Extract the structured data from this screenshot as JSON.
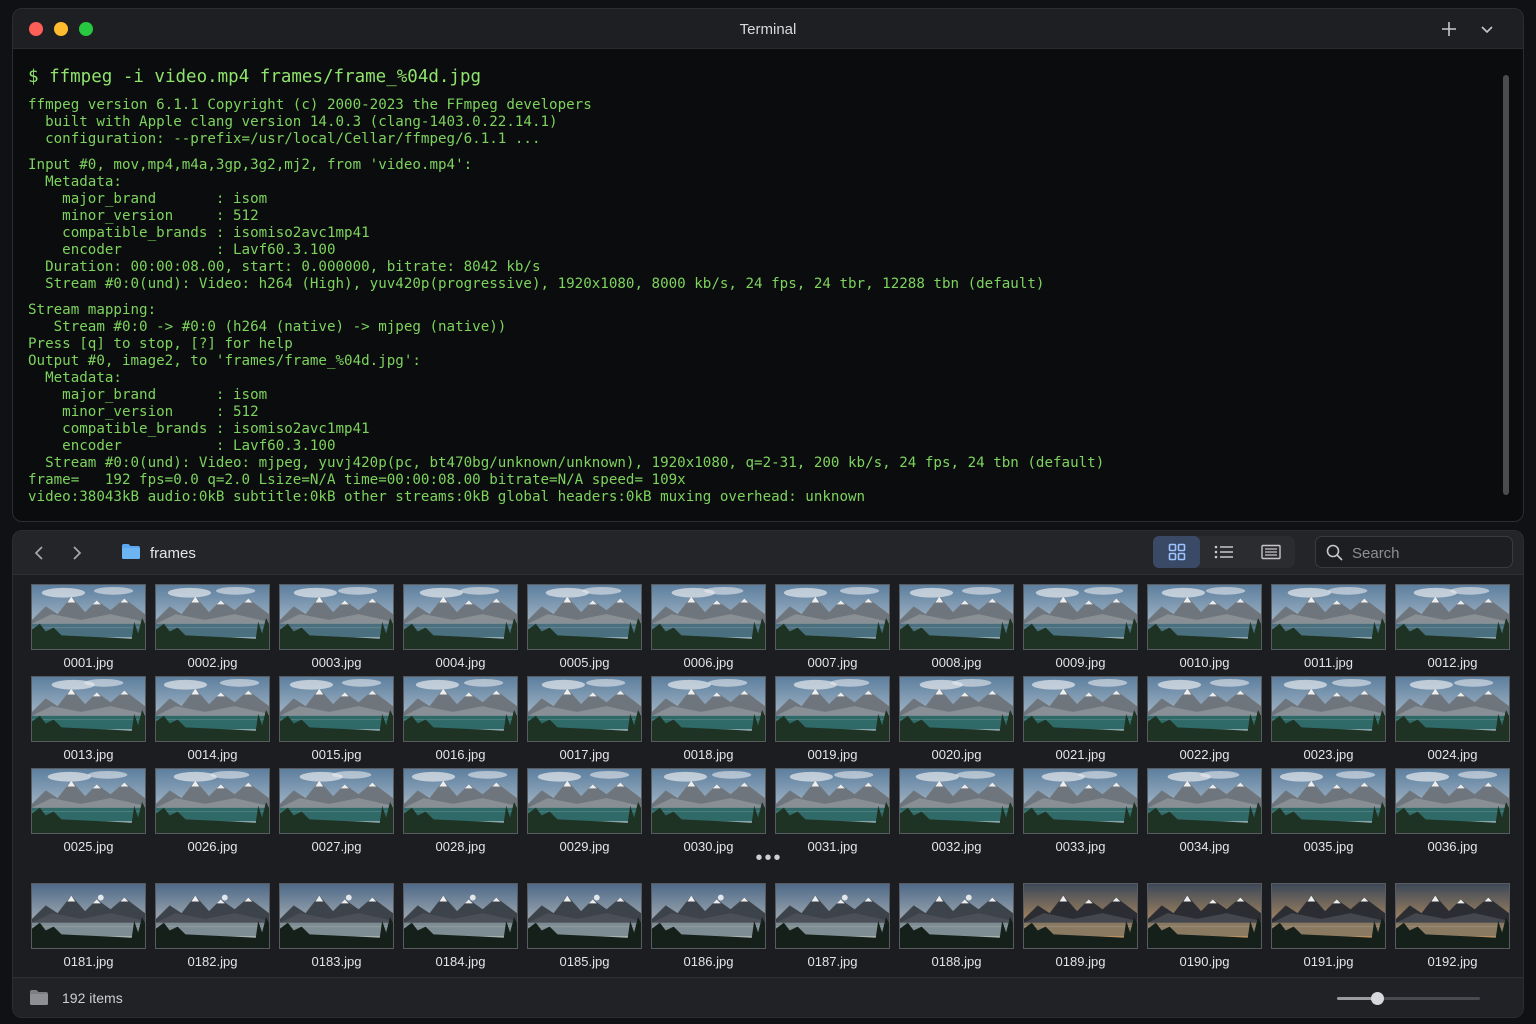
{
  "terminal": {
    "title": "Terminal",
    "command": "$ ffmpeg -i video.mp4 frames/frame_%04d.jpg",
    "blocks": [
      [
        "ffmpeg version 6.1.1 Copyright (c) 2000-2023 the FFmpeg developers",
        "  built with Apple clang version 14.0.3 (clang-1403.0.22.14.1)",
        "  configuration: --prefix=/usr/local/Cellar/ffmpeg/6.1.1 ..."
      ],
      [
        "Input #0, mov,mp4,m4a,3gp,3g2,mj2, from 'video.mp4':",
        "  Metadata:",
        "    major_brand       : isom",
        "    minor_version     : 512",
        "    compatible_brands : isomiso2avc1mp41",
        "    encoder           : Lavf60.3.100",
        "  Duration: 00:00:08.00, start: 0.000000, bitrate: 8042 kb/s",
        "  Stream #0:0(und): Video: h264 (High), yuv420p(progressive), 1920x1080, 8000 kb/s, 24 fps, 24 tbr, 12288 tbn (default)"
      ],
      [
        "Stream mapping:",
        "   Stream #0:0 -> #0:0 (h264 (native) -> mjpeg (native))",
        "Press [q] to stop, [?] for help",
        "Output #0, image2, to 'frames/frame_%04d.jpg':",
        "  Metadata:",
        "    major_brand       : isom",
        "    minor_version     : 512",
        "    compatible_brands : isomiso2avc1mp41",
        "    encoder           : Lavf60.3.100",
        "  Stream #0:0(und): Video: mjpeg, yuvj420p(pc, bt470bg/unknown/unknown), 1920x1080, q=2-31, 200 kb/s, 24 fps, 24 tbn (default)",
        "frame=   192 fps=0.0 q=2.0 Lsize=N/A time=00:00:08.00 bitrate=N/A speed= 109x",
        "video:38043kB audio:0kB subtitle:0kB other streams:0kB global headers:0kB muxing overhead: unknown"
      ]
    ]
  },
  "finder": {
    "folder": "frames",
    "search_placeholder": "Search",
    "rows": [
      [
        "0001.jpg",
        "0002.jpg",
        "0003.jpg",
        "0004.jpg",
        "0005.jpg",
        "0006.jpg",
        "0007.jpg",
        "0008.jpg",
        "0009.jpg",
        "0010.jpg",
        "0011.jpg",
        "0012.jpg"
      ],
      [
        "0013.jpg",
        "0014.jpg",
        "0015.jpg",
        "0016.jpg",
        "0017.jpg",
        "0018.jpg",
        "0019.jpg",
        "0020.jpg",
        "0021.jpg",
        "0022.jpg",
        "0023.jpg",
        "0024.jpg"
      ],
      [
        "0025.jpg",
        "0026.jpg",
        "0027.jpg",
        "0028.jpg",
        "0029.jpg",
        "0030.jpg",
        "0031.jpg",
        "0032.jpg",
        "0033.jpg",
        "0034.jpg",
        "0035.jpg",
        "0036.jpg"
      ],
      [
        "0181.jpg",
        "0182.jpg",
        "0183.jpg",
        "0184.jpg",
        "0185.jpg",
        "0186.jpg",
        "0187.jpg",
        "0188.jpg",
        "0189.jpg",
        "0190.jpg",
        "0191.jpg",
        "0192.jpg"
      ]
    ],
    "ellipsis": "•••",
    "status": "192 items",
    "zoom_level": 0.28,
    "icons": {
      "back": "chevron-left-icon",
      "forward": "chevron-right-icon",
      "grid_view": "grid-view-icon",
      "list_view": "list-view-icon",
      "column_view": "column-view-icon",
      "search": "search-icon"
    },
    "colors": {
      "terminal_text": "#7dd35e",
      "accent": "#3a4a66",
      "folder": "#5aa7ee"
    }
  }
}
